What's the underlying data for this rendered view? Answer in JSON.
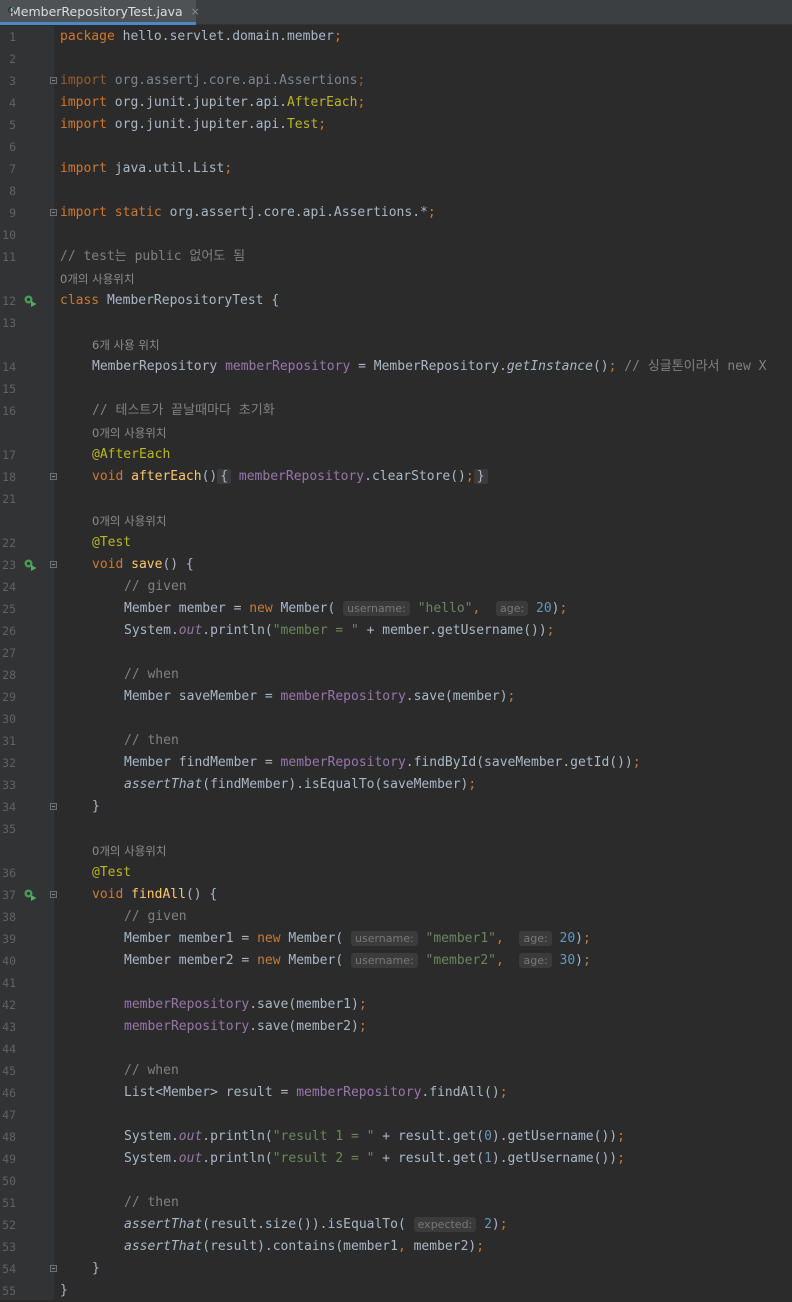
{
  "tab": {
    "title": "MemberRepositoryTest.java",
    "close": "×",
    "icon": "java-class-icon"
  },
  "colors": {
    "background": "#2b2b2b",
    "gutter": "#313335",
    "keyword": "#cc7832",
    "string": "#6a8759",
    "number": "#6897bb",
    "field": "#9876aa",
    "method": "#ffc66d",
    "annotation": "#bbb529",
    "comment": "#808080"
  },
  "lines": [
    {
      "n": "1",
      "t": "package hello.servlet.domain.member;"
    },
    {
      "n": "2",
      "t": ""
    },
    {
      "n": "3",
      "t": "import org.assertj.core.api.Assertions;"
    },
    {
      "n": "4",
      "t": "import org.junit.jupiter.api.AfterEach;"
    },
    {
      "n": "5",
      "t": "import org.junit.jupiter.api.Test;"
    },
    {
      "n": "6",
      "t": ""
    },
    {
      "n": "7",
      "t": "import java.util.List;"
    },
    {
      "n": "8",
      "t": ""
    },
    {
      "n": "9",
      "t": "import static org.assertj.core.api.Assertions.*;"
    },
    {
      "n": "10",
      "t": ""
    },
    {
      "n": "11",
      "t": "// test는 public 없어도 됨"
    },
    {
      "n": "",
      "t": "0개의 사용위치"
    },
    {
      "n": "12",
      "t": "class MemberRepositoryTest {"
    },
    {
      "n": "13",
      "t": ""
    },
    {
      "n": "",
      "t": "6개 사용 위치"
    },
    {
      "n": "14",
      "t": "MemberRepository memberRepository = MemberRepository.getInstance(); // 싱글톤이라서 new X"
    },
    {
      "n": "15",
      "t": ""
    },
    {
      "n": "16",
      "t": "// 테스트가 끝날때마다 초기화"
    },
    {
      "n": "",
      "t": "0개의 사용위치"
    },
    {
      "n": "17",
      "t": "@AfterEach"
    },
    {
      "n": "18",
      "t": "void afterEach() { memberRepository.clearStore(); }"
    },
    {
      "n": "21",
      "t": ""
    },
    {
      "n": "",
      "t": "0개의 사용위치"
    },
    {
      "n": "22",
      "t": "@Test"
    },
    {
      "n": "23",
      "t": "void save() {"
    },
    {
      "n": "24",
      "t": "// given"
    },
    {
      "n": "25",
      "t": "Member member = new Member(username: \"hello\", age: 20);"
    },
    {
      "n": "26",
      "t": "System.out.println(\"member = \" + member.getUsername());"
    },
    {
      "n": "27",
      "t": ""
    },
    {
      "n": "28",
      "t": "// when"
    },
    {
      "n": "29",
      "t": "Member saveMember = memberRepository.save(member);"
    },
    {
      "n": "30",
      "t": ""
    },
    {
      "n": "31",
      "t": "// then"
    },
    {
      "n": "32",
      "t": "Member findMember = memberRepository.findById(saveMember.getId());"
    },
    {
      "n": "33",
      "t": "assertThat(findMember).isEqualTo(saveMember);"
    },
    {
      "n": "34",
      "t": "}"
    },
    {
      "n": "35",
      "t": ""
    },
    {
      "n": "",
      "t": "0개의 사용위치"
    },
    {
      "n": "36",
      "t": "@Test"
    },
    {
      "n": "37",
      "t": "void findAll() {"
    },
    {
      "n": "38",
      "t": "// given"
    },
    {
      "n": "39",
      "t": "Member member1 = new Member(username: \"member1\", age: 20);"
    },
    {
      "n": "40",
      "t": "Member member2 = new Member(username: \"member2\", age: 30);"
    },
    {
      "n": "41",
      "t": ""
    },
    {
      "n": "42",
      "t": "memberRepository.save(member1);"
    },
    {
      "n": "43",
      "t": "memberRepository.save(member2);"
    },
    {
      "n": "44",
      "t": ""
    },
    {
      "n": "45",
      "t": "// when"
    },
    {
      "n": "46",
      "t": "List<Member> result = memberRepository.findAll();"
    },
    {
      "n": "47",
      "t": ""
    },
    {
      "n": "48",
      "t": "System.out.println(\"result 1 = \" + result.get(0).getUsername());"
    },
    {
      "n": "49",
      "t": "System.out.println(\"result 2 = \" + result.get(1).getUsername());"
    },
    {
      "n": "50",
      "t": ""
    },
    {
      "n": "51",
      "t": "// then"
    },
    {
      "n": "52",
      "t": "assertThat(result.size()).isEqualTo(expected: 2);"
    },
    {
      "n": "53",
      "t": "assertThat(result).contains(member1, member2);"
    },
    {
      "n": "54",
      "t": "}"
    },
    {
      "n": "55",
      "t": "}"
    }
  ]
}
